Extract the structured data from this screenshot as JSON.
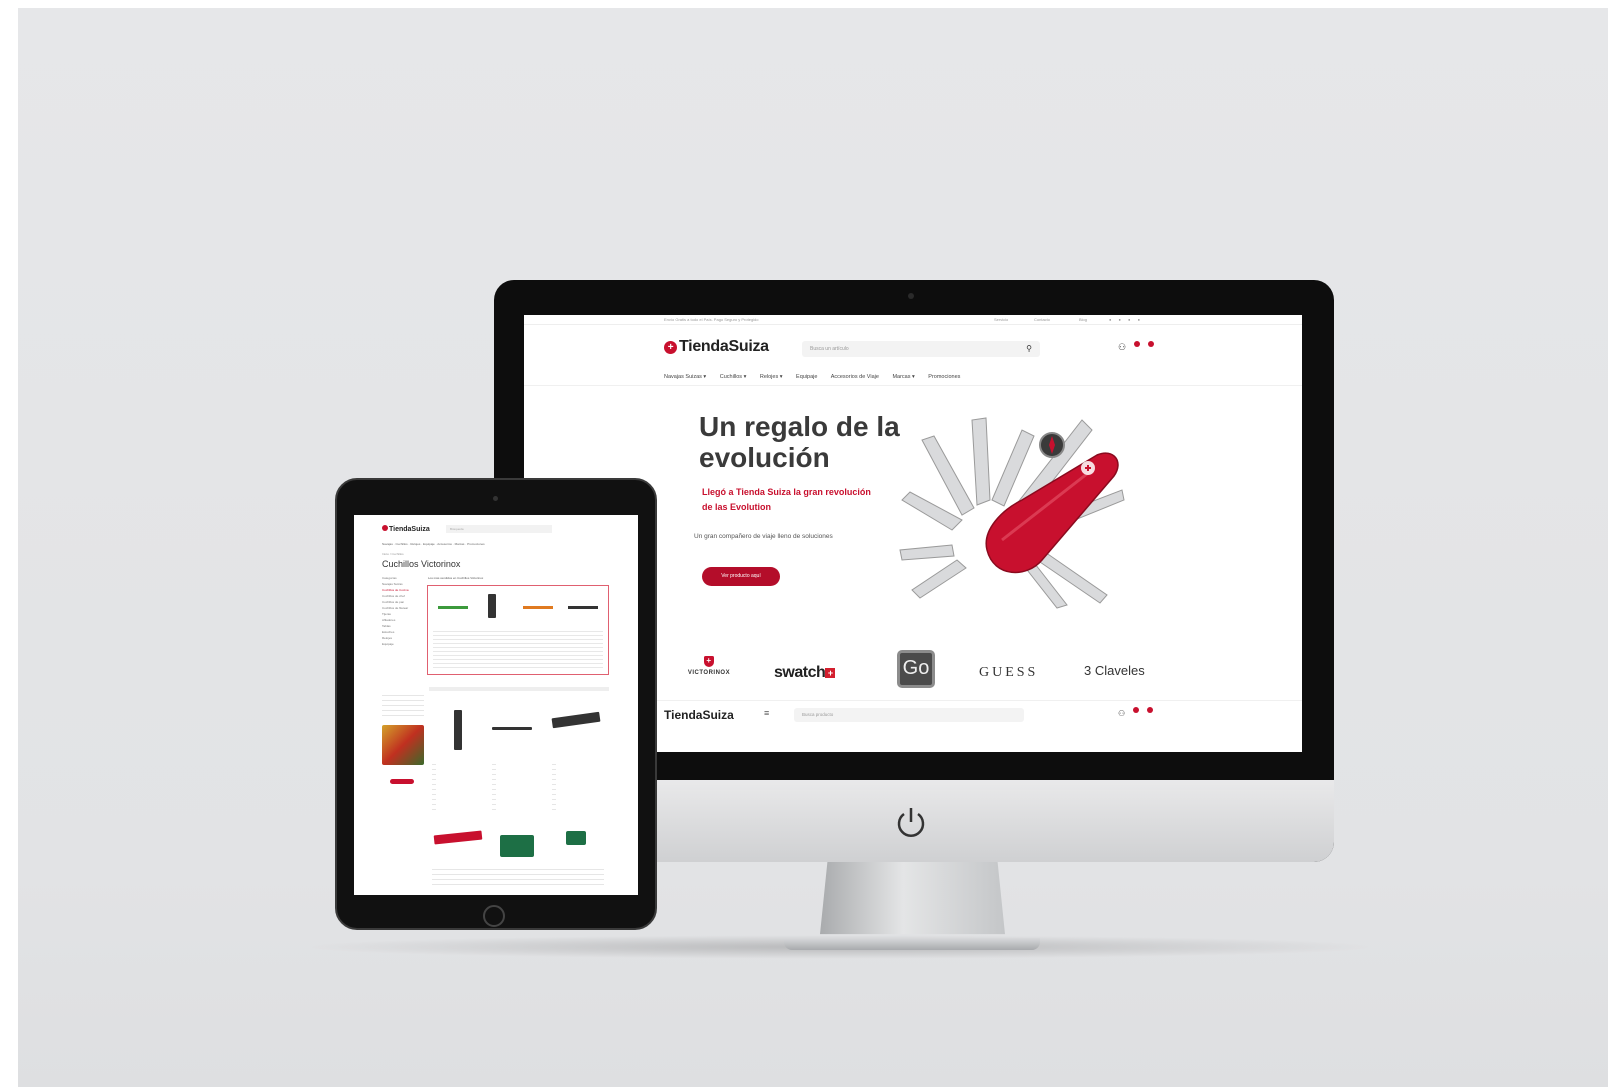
{
  "desktop": {
    "topbar": {
      "promo": "Envío Gratis a todo el País. Pago Seguro y Protegido",
      "links": [
        "Servicio",
        "Contacto",
        "Blog"
      ]
    },
    "header": {
      "logo": "TiendaSuiza",
      "search_placeholder": "Busca un artículo"
    },
    "nav": [
      "Navajas Suizas ▾",
      "Cuchillos ▾",
      "Relojes ▾",
      "Equipaje",
      "Accesorios de Viaje",
      "Marcas ▾",
      "Promociones"
    ],
    "hero": {
      "title": "Un regalo de la evolución",
      "subtitle": "Llegó a Tienda Suiza la gran revolución de las Evolution",
      "text": "Un gran compañero de viaje lleno de soluciones",
      "button": "Ver producto aquí"
    },
    "brands": [
      "VICTORINOX",
      "swatch",
      "Go",
      "GUESS",
      "3 Claveles"
    ],
    "sticky": {
      "logo": "TiendaSuiza",
      "search_placeholder": "Busca producto"
    }
  },
  "tablet": {
    "logo": "TiendaSuiza",
    "search_placeholder": "Búsqueda",
    "nav": [
      "Navajas",
      "Cuchillos",
      "Relojes",
      "Equipaje",
      "Accesorios",
      "Marcas",
      "Promociones"
    ],
    "breadcrumb": "Inicio / Cuchillos",
    "title": "Cuchillos Victorinox",
    "sidebar": [
      "Categorías",
      "Navajas Suizas",
      "Cuchillos de Cocina",
      "Cuchillos de chef",
      "Cuchillos de pan",
      "Cuchillos de filetear",
      "Tijeras",
      "Afiladores",
      "Tablas",
      "Estuches",
      "Relojes",
      "Equipaje"
    ],
    "featured_heading": "Los más vendidos en Cuchillos Victorinox"
  },
  "colors": {
    "brand_red": "#c8102e",
    "backdrop": "#e4e5e7",
    "device_black": "#0d0d0d"
  }
}
